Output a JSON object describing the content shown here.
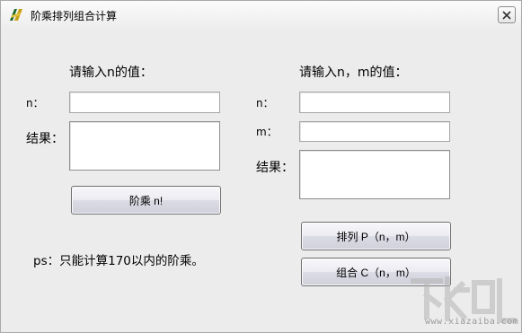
{
  "window": {
    "title": "阶乘排列组合计算",
    "close_symbol": "×"
  },
  "left_panel": {
    "heading": "请输入n的值：",
    "n_label": "n：",
    "n_value": "",
    "result_label": "结果：",
    "result_value": "",
    "factorial_button": "阶乘 n!",
    "note": "ps：只能计算170以内的阶乘。"
  },
  "right_panel": {
    "heading": "请输入n，m的值：",
    "n_label": "n：",
    "n_value": "",
    "m_label": "m：",
    "m_value": "",
    "result_label": "结果：",
    "result_value": "",
    "permutation_button": "排列 P（n，m）",
    "combination_button": "组合 C（n，m）"
  },
  "watermark": {
    "brand": "下载吧",
    "url": "www.xiazaiba.com"
  },
  "colors": {
    "window_bg": "#ececec",
    "button_border": "#707070"
  }
}
